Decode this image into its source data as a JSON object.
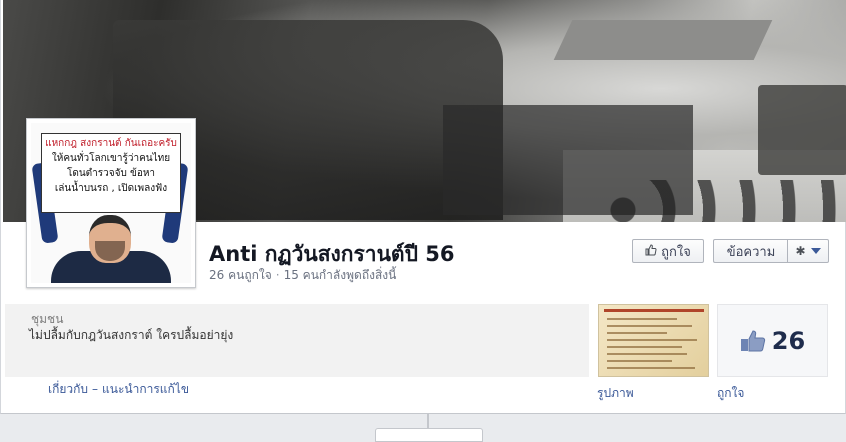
{
  "page": {
    "title": "Anti กฏวันสงกรานต์ปี 56",
    "likes_text": "26 คนถูกใจ",
    "talking_text": "15 คนกำลังพูดถึงสิ่งนี้",
    "separator": "·"
  },
  "profile_sign": {
    "line1": "แหกกฎ สงกรานต์ กันเถอะครับ",
    "line2": "ให้คนทั่วโลกเขารู้ว่าคนไทย",
    "line3": "โดนตำรวจจับ ข้อหา",
    "line4": "เล่นน้ำบนรถ , เปิดเพลงฟัง"
  },
  "actions": {
    "like_label": "ถูกใจ",
    "message_label": "ข้อความ",
    "settings_icon": "gear-icon",
    "like_icon": "thumbs-up-icon"
  },
  "about": {
    "category": "ชุมชน",
    "description": "ไม่ปลื้มกับกฎวันสงกราต์ ใครปลื้มอย่ายุ่ง",
    "link_about": "เกี่ยวกับ",
    "link_dash": "–",
    "link_suggest": "แนะนำการแก้ไข"
  },
  "photos": {
    "caption": "รูปภาพ"
  },
  "likes": {
    "count": "26",
    "caption": "ถูกใจ"
  },
  "colors": {
    "link": "#3b5998",
    "title": "#141823",
    "muted": "#6a7180"
  }
}
